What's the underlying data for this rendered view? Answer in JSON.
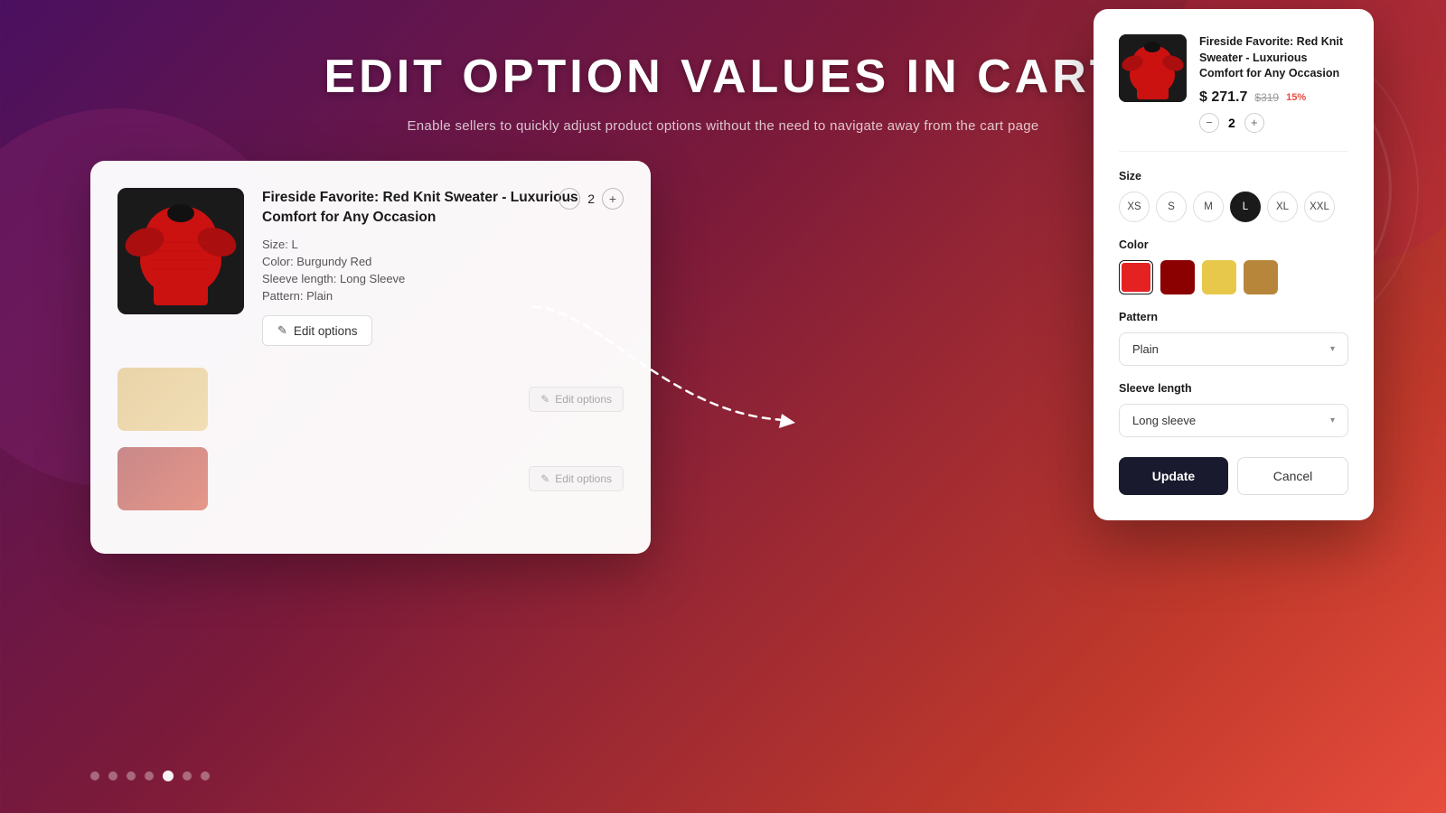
{
  "header": {
    "title": "EDIT OPTION VALUES IN CART",
    "subtitle": "Enable sellers to quickly adjust product options without the need to navigate away from the cart page"
  },
  "cart": {
    "item": {
      "title": "Fireside Favorite: Red Knit Sweater - Luxurious Comfort for Any Occasion",
      "options": {
        "size": "Size: L",
        "color": "Color: Burgundy Red",
        "sleeve": "Sleeve length: Long Sleeve",
        "pattern": "Pattern: Plain"
      },
      "quantity": "2",
      "edit_button": "Edit options"
    },
    "ghost_items": [
      {
        "edit_label": "Edit options"
      },
      {
        "edit_label": "Edit options"
      }
    ]
  },
  "modal": {
    "product_name": "Fireside Favorite: Red Knit Sweater - Luxurious Comfort for Any Occasion",
    "price_current": "$ 271.7",
    "price_original": "$319",
    "price_discount": "15%",
    "quantity": "2",
    "size_section_label": "Size",
    "sizes": [
      "XS",
      "S",
      "M",
      "L",
      "XL",
      "XXL"
    ],
    "selected_size": "L",
    "color_section_label": "Color",
    "colors": [
      "red",
      "dark-red",
      "yellow",
      "tan"
    ],
    "selected_color": "red",
    "pattern_section_label": "Pattern",
    "pattern_value": "Plain",
    "sleeve_section_label": "Sleeve length",
    "sleeve_value": "Long sleeve",
    "update_label": "Update",
    "cancel_label": "Cancel"
  },
  "pagination": {
    "dots": [
      1,
      2,
      3,
      4,
      5,
      6,
      7
    ],
    "active_index": 4
  },
  "icons": {
    "pencil": "✎",
    "minus": "−",
    "plus": "+",
    "chevron_down": "▾"
  }
}
